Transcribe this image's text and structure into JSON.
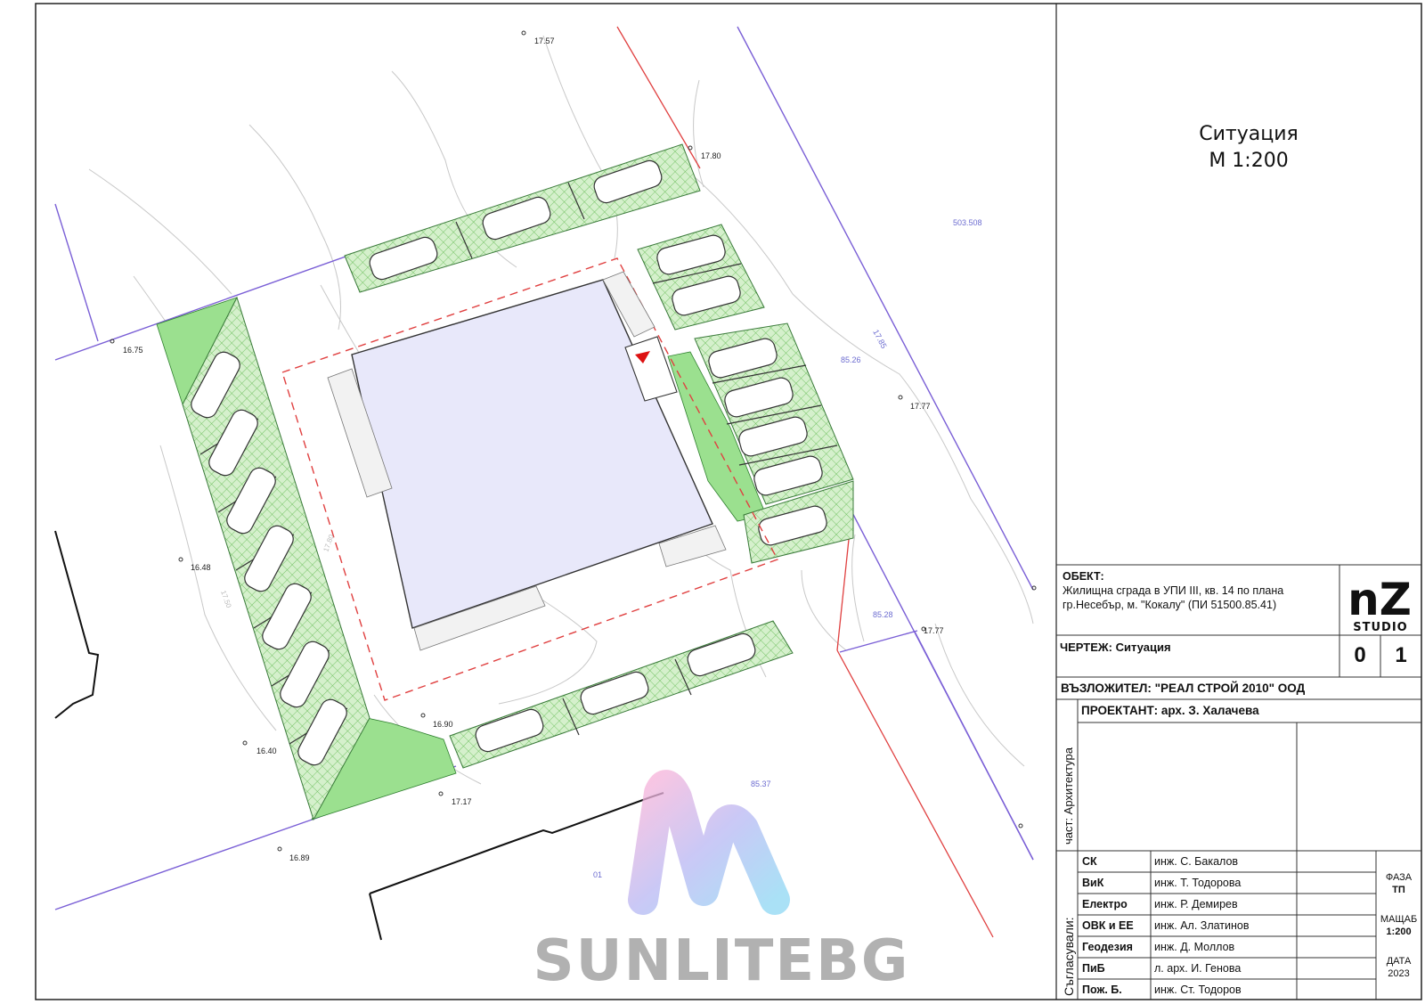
{
  "sheet": {
    "title": "Ситуация",
    "scale": "М 1:200"
  },
  "plan": {
    "elevations": [
      "17.57",
      "17.80",
      "16.75",
      "17.77",
      "16.48",
      "16.40",
      "16.90",
      "17.17",
      "16.89",
      "17.77"
    ],
    "labels": [
      "503.508",
      "85.26",
      "85.28",
      "85.37",
      "01",
      "17.85",
      "17.80",
      "17.50"
    ],
    "colors": {
      "building": "#e8e8fa",
      "green": "#9be08f",
      "hatch": "#cdeec4",
      "red_line": "#e04040",
      "blue_line": "#7a5fd6"
    }
  },
  "titleblock": {
    "object_label": "ОБЕКТ:",
    "object_line1": "Жилищна сграда в УПИ III, кв. 14 по плана",
    "object_line2": "гр.Несебър, м. \"Кокалу\" (ПИ 51500.85.41)",
    "logo_top": "nZ",
    "logo_bottom": "STUDIO",
    "drawing": "ЧЕРТЕЖ: Ситуация",
    "sheet_no_1": "0",
    "sheet_no_2": "1",
    "client": "ВЪЗЛОЖИТЕЛ:  \"РЕАЛ СТРОЙ 2010\" ООД",
    "part": "част: Архитектура",
    "designer": "ПРОЕКТАНТ: арх. З. Халачева",
    "agreed": "Съгласували:",
    "approvals": [
      {
        "role": "СК",
        "name": "инж. С. Бакалов"
      },
      {
        "role": "ВиК",
        "name": "инж. Т. Тодорова"
      },
      {
        "role": "Електро",
        "name": "инж. Р. Демирев"
      },
      {
        "role": "ОВК и ЕЕ",
        "name": "инж. Ал. Златинов"
      },
      {
        "role": "Геодезия",
        "name": "инж. Д. Моллов"
      },
      {
        "role": "ПиБ",
        "name": "л. арх. И. Генова"
      },
      {
        "role": "Пож. Б.",
        "name": "инж. Ст. Тодоров"
      }
    ],
    "phase_label": "ФАЗА",
    "phase_value": "ТП",
    "scale_label": "МАЩАБ",
    "scale_value": "1:200",
    "date_label": "ДАТА",
    "date_value": "2023"
  },
  "watermark": {
    "text": "SUNLITEBG"
  }
}
